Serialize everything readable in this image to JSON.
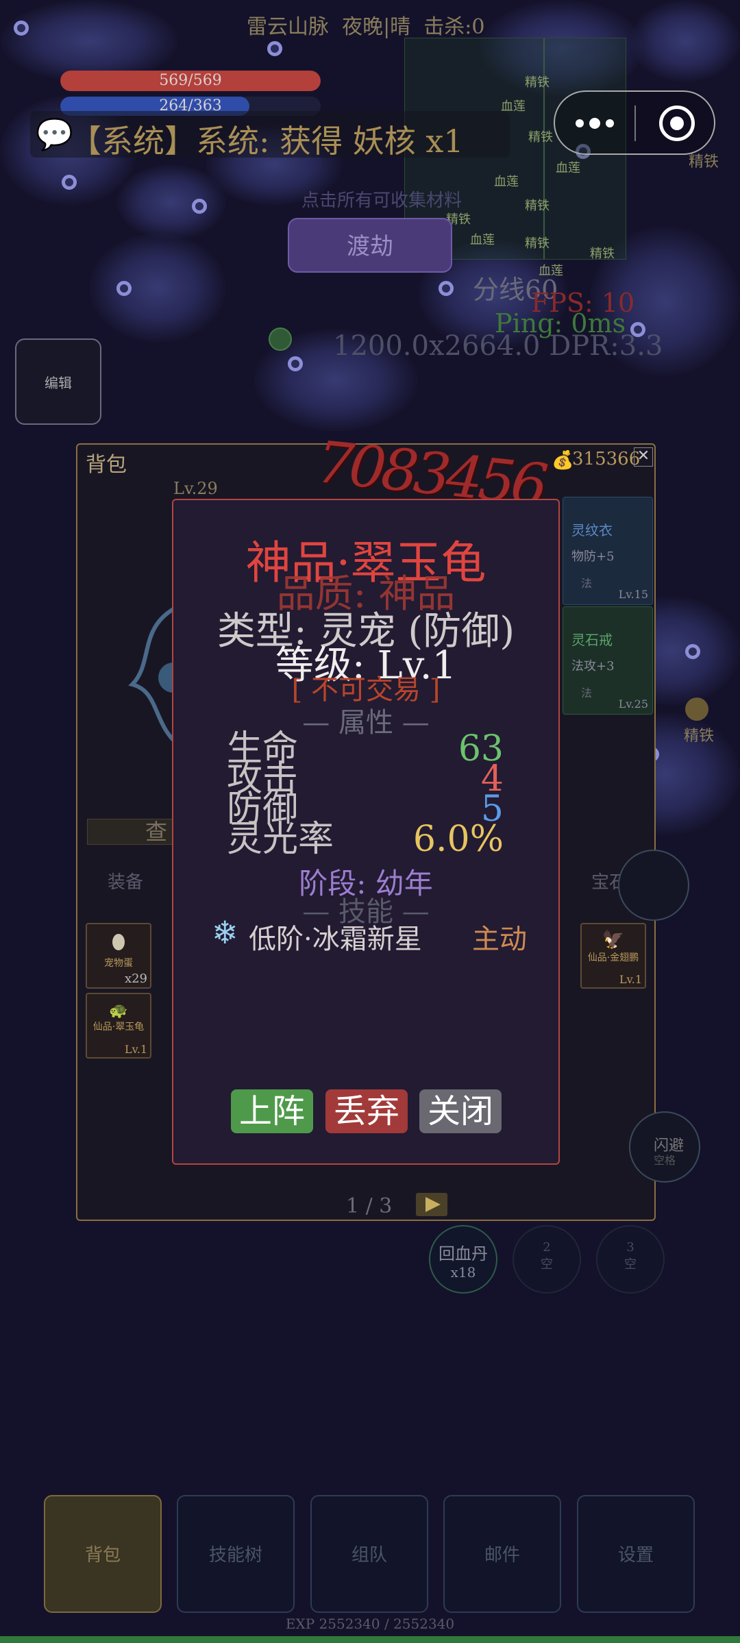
{
  "hud": {
    "location": "雷云山脉  夜晚|晴  击杀:0",
    "hp_text": "569/569",
    "hp_ratio": 1.0,
    "mp_text": "264/363",
    "mp_ratio": 0.727,
    "system_message": "【系统】系统: 获得 妖核 x1",
    "tribulation_button": "渡劫",
    "channel": "分线60",
    "fps": "FPS: 10",
    "ping": "Ping: 0ms",
    "resolution": "1200.0x2664.0 DPR:3.3",
    "edit_button": "编辑",
    "hint_faded": "点击所有可收集材料",
    "iron_label_1": "精铁",
    "iron_label_2": "精铁"
  },
  "minimap": {
    "labels": [
      "精铁",
      "血莲",
      "精铁",
      "血莲",
      "血莲",
      "精铁",
      "精铁",
      "血莲",
      "血莲",
      "精铁",
      "精铁"
    ]
  },
  "backpack": {
    "title": "背包",
    "gold": "315366",
    "close_icon": "close-icon",
    "level": "Lv.29",
    "check_button": "查",
    "tabs": [
      "装备",
      "宝石"
    ],
    "page": "1 / 3",
    "items_right": [
      {
        "name": "灵纹衣",
        "stat": "物防+5",
        "tag": "法",
        "level": "Lv.15"
      },
      {
        "name": "灵石戒",
        "stat": "法攻+3",
        "tag": "法",
        "level": "Lv.25"
      }
    ],
    "slots": [
      {
        "name": "宠物蛋",
        "count": "x29"
      },
      {
        "name": "仙品·金翅鹏",
        "count": "Lv.1"
      },
      {
        "name": "仙品·翠玉龟",
        "count": "Lv.1"
      }
    ]
  },
  "damage_number": "7083456",
  "modal": {
    "title": "神品·翠玉龟",
    "quality": "品质: 神品",
    "type": "类型: 灵宠 (防御)",
    "level": "等级: Lv.1",
    "tradable": "[ 不可交易 ]",
    "attr_header": "— 属性 —",
    "attributes": [
      {
        "label": "生命",
        "value": "63",
        "color": "#6cc36c"
      },
      {
        "label": "攻击",
        "value": "4",
        "color": "#e0605a"
      },
      {
        "label": "防御",
        "value": "5",
        "color": "#5b9be6"
      },
      {
        "label": "灵光率",
        "value": "6.0%",
        "color": "#e8c460"
      }
    ],
    "stage": "阶段: 幼年",
    "skill_header": "— 技能 —",
    "skill_name": "低阶·冰霜新星",
    "skill_type": "主动",
    "buttons": {
      "deploy": "上阵",
      "discard": "丢弃",
      "close": "关闭"
    }
  },
  "quickbar": [
    {
      "label": "回血丹",
      "sub": "x18"
    },
    {
      "label": "2",
      "sub": "空"
    },
    {
      "label": "3",
      "sub": "空"
    }
  ],
  "dodge": {
    "label": "闪避",
    "sub": "空格"
  },
  "nav_tabs": [
    "背包",
    "技能树",
    "组队",
    "邮件",
    "设置"
  ],
  "exp_text": "EXP 2552340 / 2552340",
  "colors": {
    "accent_gold": "#b89a5a",
    "modal_border": "#b34540",
    "title_red": "#e0453f"
  }
}
